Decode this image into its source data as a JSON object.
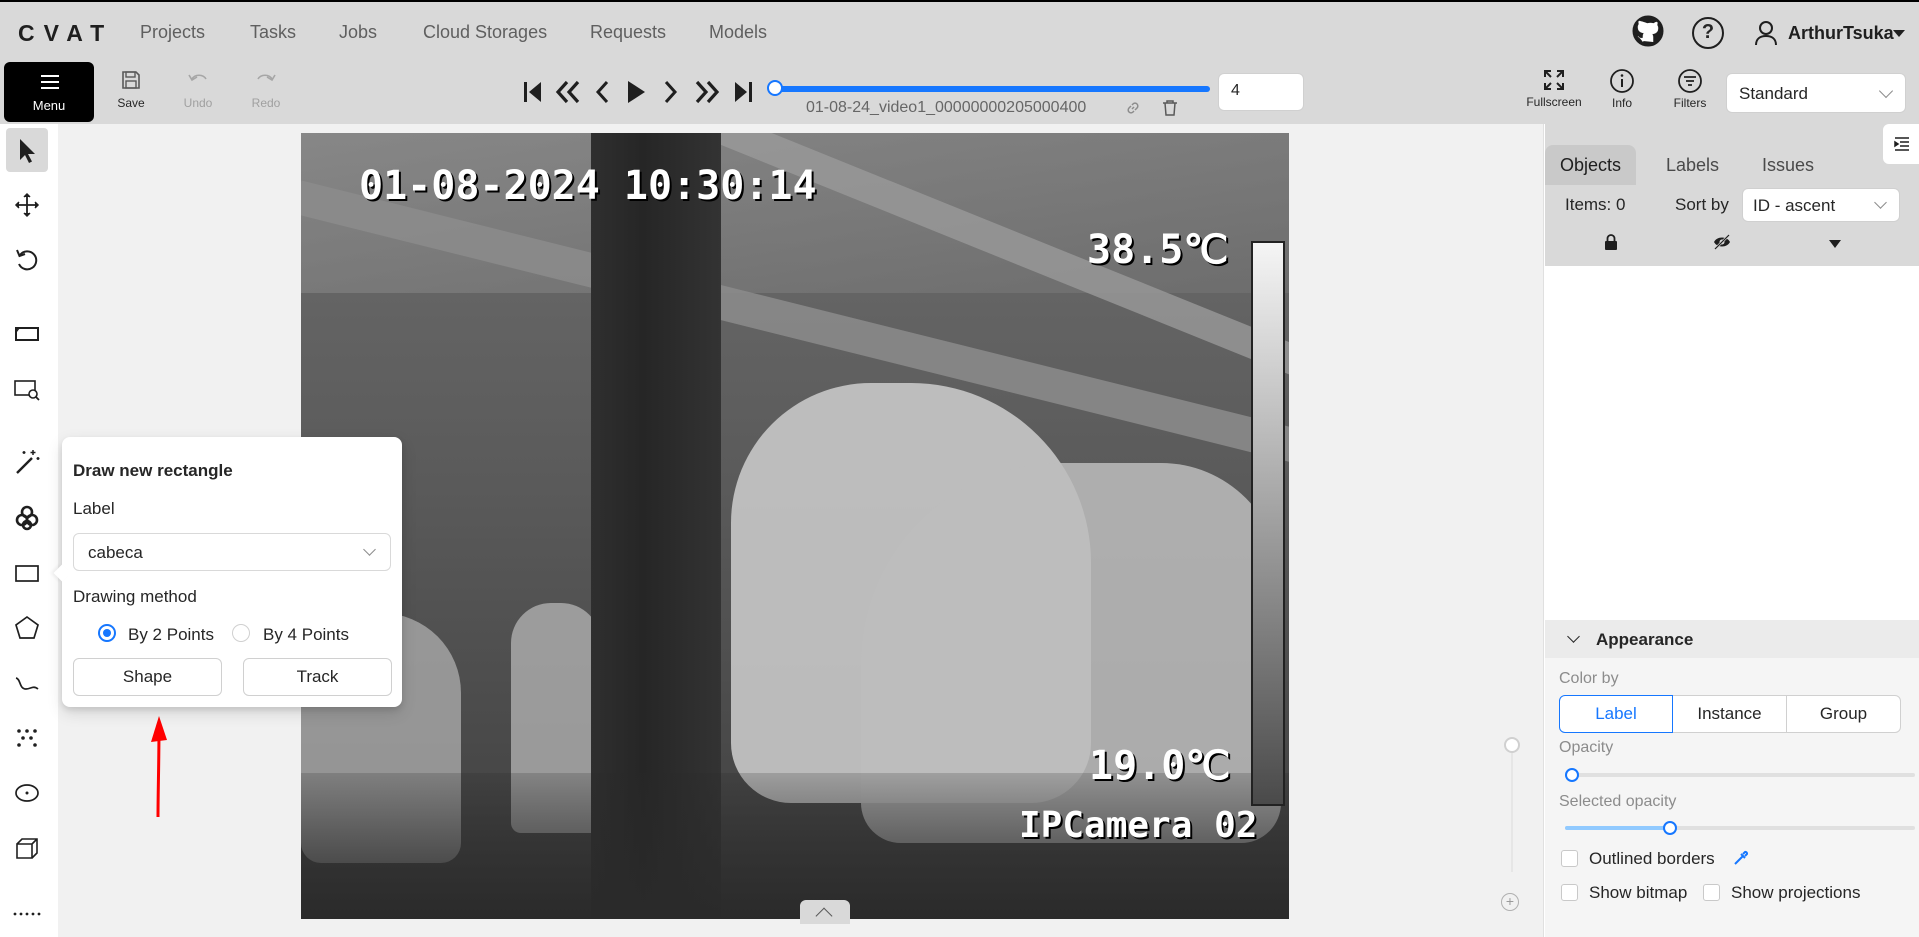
{
  "nav": {
    "logo": "CVAT",
    "links": [
      "Projects",
      "Tasks",
      "Jobs",
      "Cloud Storages",
      "Requests",
      "Models"
    ],
    "username": "ArthurTsuka",
    "help": "?"
  },
  "toolbar": {
    "menu_label": "Menu",
    "save_label": "Save",
    "undo_label": "Undo",
    "redo_label": "Redo",
    "frame_name": "01-08-24_video1_00000000205000400",
    "frame_number": "4",
    "fullscreen_label": "Fullscreen",
    "info_label": "Info",
    "filters_label": "Filters",
    "workspace": "Standard"
  },
  "frame": {
    "timestamp": "01-08-2024 10:30:14",
    "temp_max": "38.5℃",
    "temp_min": "19.0℃",
    "camera": "IPCamera 02"
  },
  "popover": {
    "title": "Draw new rectangle",
    "label_caption": "Label",
    "label_value": "cabeca",
    "method_caption": "Drawing method",
    "option_2": "By 2 Points",
    "option_4": "By 4 Points",
    "selected": "By 2 Points",
    "shape_button": "Shape",
    "track_button": "Track"
  },
  "sidebar": {
    "tabs": [
      "Objects",
      "Labels",
      "Issues"
    ],
    "active_tab": "Objects",
    "items_label": "Items: 0",
    "sort_by_label": "Sort by",
    "sort_value": "ID - ascent"
  },
  "appearance": {
    "title": "Appearance",
    "color_by_label": "Color by",
    "color_by_options": [
      "Label",
      "Instance",
      "Group"
    ],
    "color_by_selected": "Label",
    "opacity_label": "Opacity",
    "opacity_value": 0.02,
    "selected_opacity_label": "Selected opacity",
    "selected_opacity_value": 0.3,
    "outlined_borders": "Outlined borders",
    "show_bitmap": "Show bitmap",
    "show_projections": "Show projections"
  },
  "colors": {
    "accent": "#1677ff",
    "toolbar_bg": "#d9d9d9",
    "annotation_arrow": "#ff0000"
  }
}
